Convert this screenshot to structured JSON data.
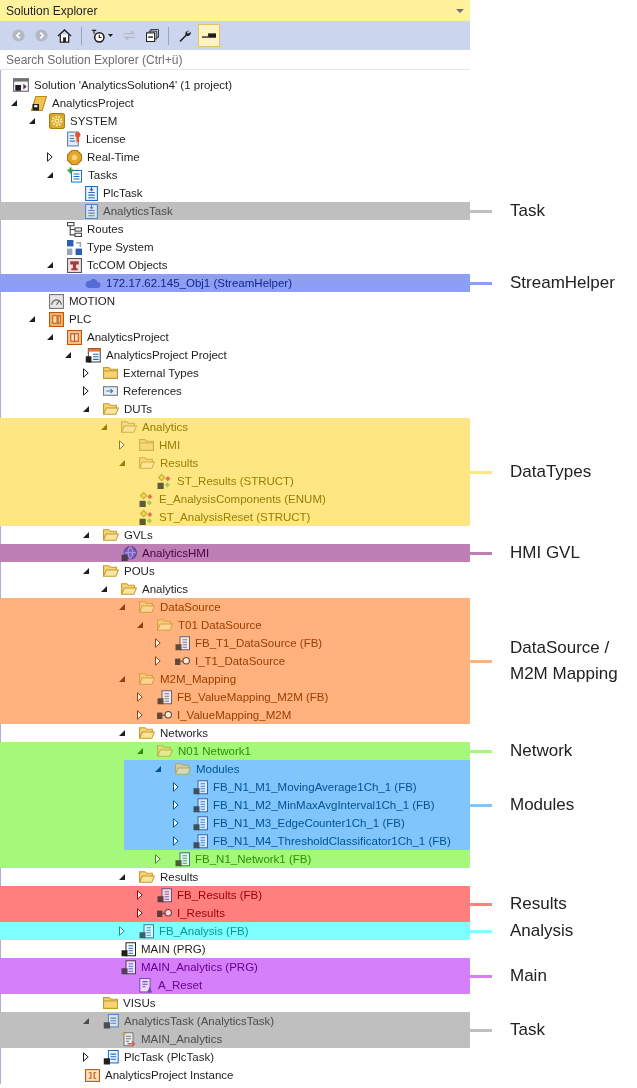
{
  "window": {
    "title": "Solution Explorer"
  },
  "toolbar": [
    {
      "kind": "back",
      "disabled": true,
      "on": false
    },
    {
      "kind": "forward",
      "disabled": true,
      "on": false
    },
    {
      "kind": "home",
      "disabled": false,
      "on": false
    },
    {
      "kind": "separator"
    },
    {
      "kind": "history",
      "disabled": false,
      "on": false,
      "dropdown": true
    },
    {
      "kind": "sync",
      "disabled": true,
      "on": false
    },
    {
      "kind": "collapse_all",
      "disabled": false,
      "on": false
    },
    {
      "kind": "separator"
    },
    {
      "kind": "properties",
      "disabled": false,
      "on": false
    },
    {
      "kind": "preview",
      "disabled": false,
      "on": true
    }
  ],
  "search": {
    "placeholder": "Search Solution Explorer (Ctrl+ü)"
  },
  "tree": [
    {
      "kind": "solution",
      "label": "Solution 'AnalyticsSolution4' (1 project)",
      "children": [
        {
          "kind": "twincat_project",
          "label": "AnalyticsProject",
          "expanded": true,
          "children": [
            {
              "kind": "system",
              "label": "SYSTEM",
              "expanded": true,
              "children": [
                {
                  "kind": "license",
                  "label": "License"
                },
                {
                  "kind": "realtime",
                  "label": "Real-Time",
                  "expanded": false
                },
                {
                  "kind": "tasks",
                  "label": "Tasks",
                  "expanded": true,
                  "children": [
                    {
                      "kind": "task",
                      "label": "PlcTask"
                    },
                    {
                      "kind": "highlight",
                      "label": "Task",
                      "color": "#bfbfbf",
                      "children": [
                        {
                          "kind": "task",
                          "label": "AnalyticsTask"
                        }
                      ]
                    }
                  ]
                },
                {
                  "kind": "routes",
                  "label": "Routes"
                },
                {
                  "kind": "type_system",
                  "label": "Type System"
                },
                {
                  "kind": "tcom",
                  "label": "TcCOM Objects",
                  "expanded": true,
                  "children": [
                    {
                      "kind": "highlight",
                      "label": "StreamHelper",
                      "color": "#8c9ff5",
                      "children": [
                        {
                          "kind": "object",
                          "label": "172.17.62.145_Obj1 (StreamHelper)"
                        }
                      ]
                    }
                  ]
                }
              ]
            },
            {
              "kind": "motion",
              "label": "MOTION"
            },
            {
              "kind": "plc",
              "label": "PLC",
              "expanded": true,
              "children": [
                {
                  "kind": "plc_project",
                  "label": "AnalyticsProject",
                  "expanded": true,
                  "children": [
                    {
                      "kind": "plc_file",
                      "label": "AnalyticsProject Project",
                      "expanded": true,
                      "children": [
                        {
                          "kind": "folder",
                          "label": "External Types",
                          "expanded": false
                        },
                        {
                          "kind": "references",
                          "label": "References",
                          "expanded": false
                        },
                        {
                          "kind": "folder",
                          "label": "DUTs",
                          "expanded": true,
                          "children": [
                            {
                              "kind": "highlight",
                              "label": "DataTypes",
                              "color": "#fee783",
                              "children": [
                                {
                                  "kind": "folder",
                                  "label": "Analytics",
                                  "expanded": true,
                                  "children": [
                                    {
                                      "kind": "folder",
                                      "label": "HMI",
                                      "expanded": false
                                    },
                                    {
                                      "kind": "folder",
                                      "label": "Results",
                                      "expanded": true,
                                      "children": [
                                        {
                                          "kind": "dut",
                                          "label": "ST_Results (STRUCT)"
                                        }
                                      ]
                                    },
                                    {
                                      "kind": "dut",
                                      "label": "E_AnalysisComponents (ENUM)"
                                    },
                                    {
                                      "kind": "dut",
                                      "label": "ST_AnalysisReset (STRUCT)"
                                    }
                                  ]
                                }
                              ]
                            }
                          ]
                        },
                        {
                          "kind": "folder",
                          "label": "GVLs",
                          "expanded": true,
                          "children": [
                            {
                              "kind": "highlight",
                              "label": "HMI GVL",
                              "color": "#be7fb6",
                              "children": [
                                {
                                  "kind": "gvl",
                                  "label": "AnalyticsHMI"
                                }
                              ]
                            }
                          ]
                        },
                        {
                          "kind": "folder",
                          "label": "POUs",
                          "expanded": true,
                          "children": [
                            {
                              "kind": "folder",
                              "label": "Analytics",
                              "expanded": true,
                              "children": [
                                {
                                  "kind": "highlight",
                                  "label": "DataSource / M2M Mapping",
                                  "color": "#ffb27d",
                                  "children": [
                                    {
                                      "kind": "folder",
                                      "label": "DataSource",
                                      "expanded": true,
                                      "children": [
                                        {
                                          "kind": "folder",
                                          "label": "T01 DataSource",
                                          "expanded": true,
                                          "children": [
                                            {
                                              "kind": "fb",
                                              "label": "FB_T1_DataSource (FB)",
                                              "expanded": false
                                            },
                                            {
                                              "kind": "interface",
                                              "label": "I_T1_DataSource",
                                              "expanded": false
                                            }
                                          ]
                                        }
                                      ]
                                    },
                                    {
                                      "kind": "folder",
                                      "label": "M2M_Mapping",
                                      "expanded": true,
                                      "children": [
                                        {
                                          "kind": "fb",
                                          "label": "FB_ValueMapping_M2M (FB)",
                                          "expanded": false
                                        },
                                        {
                                          "kind": "interface",
                                          "label": "I_ValueMapping_M2M",
                                          "expanded": false
                                        }
                                      ]
                                    }
                                  ]
                                },
                                {
                                  "kind": "folder",
                                  "label": "Networks",
                                  "expanded": true,
                                  "children": [
                                    {
                                      "kind": "highlight",
                                      "label": "Network",
                                      "color": "#a4f97b",
                                      "children": [
                                        {
                                          "kind": "folder",
                                          "label": "N01 Network1",
                                          "expanded": true,
                                          "children": [
                                            {
                                              "kind": "highlight",
                                              "label": "Modules",
                                              "color": "#80c5fc",
                                              "children": [
                                                {
                                                  "kind": "folder",
                                                  "label": "Modules",
                                                  "expanded": true,
                                                  "children": [
                                                    {
                                                      "kind": "fb",
                                                      "label": "FB_N1_M1_MovingAverage1Ch_1 (FB)",
                                                      "expanded": false
                                                    },
                                                    {
                                                      "kind": "fb",
                                                      "label": "FB_N1_M2_MinMaxAvgInterval1Ch_1 (FB)",
                                                      "expanded": false
                                                    },
                                                    {
                                                      "kind": "fb",
                                                      "label": "FB_N1_M3_EdgeCounter1Ch_1 (FB)",
                                                      "expanded": false
                                                    },
                                                    {
                                                      "kind": "fb",
                                                      "label": "FB_N1_M4_ThresholdClassificator1Ch_1 (FB)",
                                                      "expanded": false
                                                    }
                                                  ]
                                                }
                                              ]
                                            },
                                            {
                                              "kind": "fb",
                                              "label": "FB_N1_Network1 (FB)",
                                              "expanded": false
                                            }
                                          ]
                                        }
                                      ]
                                    }
                                  ]
                                },
                                {
                                  "kind": "folder",
                                  "label": "Results",
                                  "expanded": true,
                                  "children": [
                                    {
                                      "kind": "highlight",
                                      "label": "Results",
                                      "color": "#ff7f7f",
                                      "children": [
                                        {
                                          "kind": "fb",
                                          "label": "FB_Results (FB)",
                                          "expanded": false
                                        },
                                        {
                                          "kind": "interface",
                                          "label": "I_Results",
                                          "expanded": false
                                        }
                                      ]
                                    }
                                  ]
                                },
                                {
                                  "kind": "highlight",
                                  "label": "Analysis",
                                  "color": "#80ffff",
                                  "children": [
                                    {
                                      "kind": "fb",
                                      "label": "FB_Analysis (FB)",
                                      "expanded": false
                                    }
                                  ]
                                }
                              ]
                            },
                            {
                              "kind": "prg",
                              "label": "MAIN (PRG)"
                            },
                            {
                              "kind": "highlight",
                              "label": "Main",
                              "color": "#d57ffa",
                              "children": [
                                {
                                  "kind": "prg",
                                  "label": "MAIN_Analytics (PRG)",
                                  "children": [
                                    {
                                      "kind": "action",
                                      "label": "A_Reset"
                                    }
                                  ]
                                }
                              ]
                            }
                          ]
                        },
                        {
                          "kind": "folder",
                          "label": "VISUs"
                        },
                        {
                          "kind": "highlight",
                          "label": "Task",
                          "color": "#bfbfbf",
                          "children": [
                            {
                              "kind": "plc_task",
                              "label": "AnalyticsTask (AnalyticsTask)",
                              "expanded": true,
                              "children": [
                                {
                                  "kind": "task_ref",
                                  "label": "MAIN_Analytics"
                                }
                              ]
                            }
                          ]
                        },
                        {
                          "kind": "plc_task",
                          "label": "PlcTask (PlcTask)",
                          "expanded": false
                        }
                      ]
                    },
                    {
                      "kind": "instance",
                      "label": "AnalyticsProject Instance"
                    }
                  ]
                }
              ]
            }
          ]
        }
      ]
    }
  ]
}
